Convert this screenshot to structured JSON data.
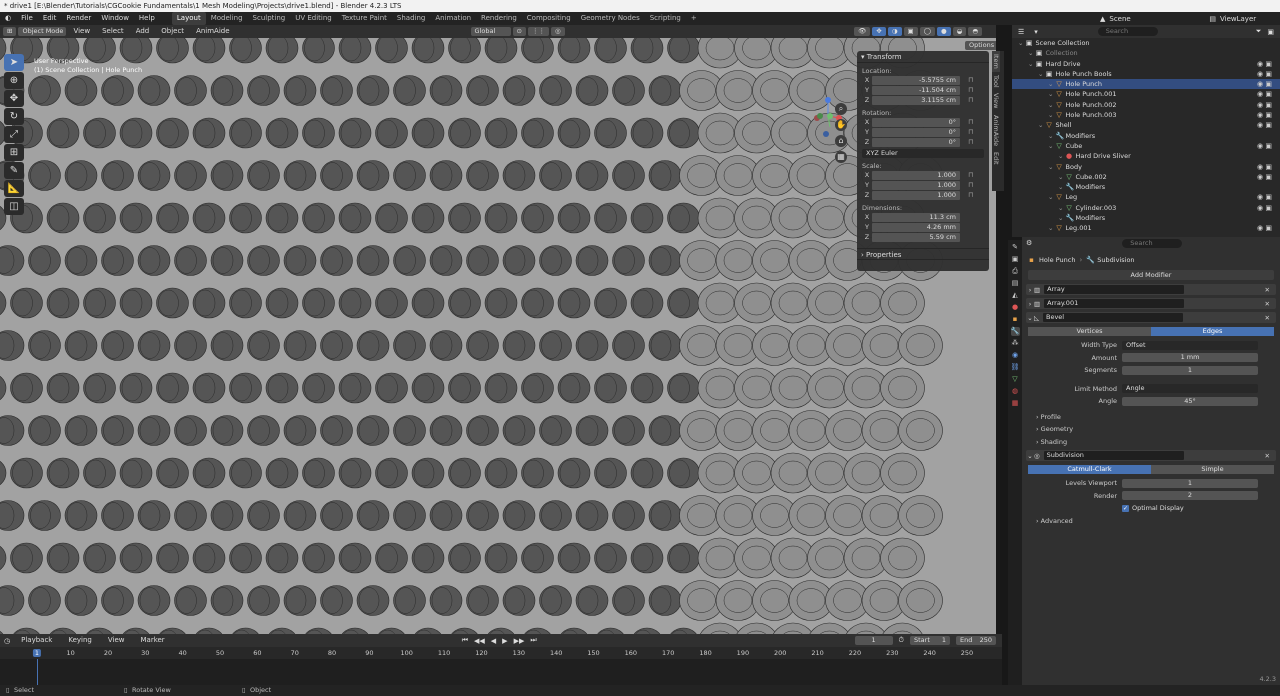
{
  "window_title": "* drive1 [E:\\Blender\\Tutorials\\CGCookie Fundamentals\\1 Mesh Modeling\\Projects\\drive1.blend] - Blender 4.2.3 LTS",
  "menu": [
    "File",
    "Edit",
    "Render",
    "Window",
    "Help"
  ],
  "workspaces": [
    "Layout",
    "Modeling",
    "Sculpting",
    "UV Editing",
    "Texture Paint",
    "Shading",
    "Animation",
    "Rendering",
    "Compositing",
    "Geometry Nodes",
    "Scripting"
  ],
  "active_workspace": "Layout",
  "scene": "Scene",
  "view_layer": "ViewLayer",
  "viewport_header": {
    "mode": "Object Mode",
    "menus": [
      "View",
      "Select",
      "Add",
      "Object",
      "AnimAide"
    ],
    "orientation": "Global",
    "options": "Options"
  },
  "viewport": {
    "perspective": "User Perspective",
    "context": "(1) Scene Collection | Hole Punch"
  },
  "tools": [
    "cursor",
    "select",
    "move",
    "rotate",
    "scale",
    "transform",
    "annotate",
    "measure",
    "add-cube"
  ],
  "npanel": {
    "title": "Transform",
    "location_label": "Location:",
    "location": [
      "-5.5755 cm",
      "-11.504 cm",
      "3.1155 cm"
    ],
    "rotation_label": "Rotation:",
    "rotation": [
      "0°",
      "0°",
      "0°"
    ],
    "rotation_mode": "XYZ Euler",
    "scale_label": "Scale:",
    "scale": [
      "1.000",
      "1.000",
      "1.000"
    ],
    "dimensions_label": "Dimensions:",
    "dimensions": [
      "11.3 cm",
      "4.26 mm",
      "5.59 cm"
    ],
    "axes": [
      "X",
      "Y",
      "Z"
    ],
    "properties": "Properties",
    "tabs": [
      "Item",
      "Tool",
      "View",
      "AnimAide",
      "Edit"
    ]
  },
  "outliner": {
    "search_placeholder": "Search",
    "items": [
      {
        "label": "Scene Collection",
        "indent": 0,
        "icon": "w"
      },
      {
        "label": "Collection",
        "indent": 1,
        "icon": "w",
        "dim": true
      },
      {
        "label": "Hard Drive",
        "indent": 1,
        "icon": "w"
      },
      {
        "label": "Hole Punch Bools",
        "indent": 2,
        "icon": "w"
      },
      {
        "label": "Hole Punch",
        "indent": 3,
        "icon": "o",
        "sel": true
      },
      {
        "label": "Hole Punch.001",
        "indent": 3,
        "icon": "o"
      },
      {
        "label": "Hole Punch.002",
        "indent": 3,
        "icon": "o"
      },
      {
        "label": "Hole Punch.003",
        "indent": 3,
        "icon": "o"
      },
      {
        "label": "Shell",
        "indent": 2,
        "icon": "o"
      },
      {
        "label": "Modifiers",
        "indent": 3,
        "icon": "b"
      },
      {
        "label": "Cube",
        "indent": 3,
        "icon": "g"
      },
      {
        "label": "Hard Drive Sliver",
        "indent": 4,
        "icon": "r"
      },
      {
        "label": "Body",
        "indent": 3,
        "icon": "o"
      },
      {
        "label": "Cube.002",
        "indent": 4,
        "icon": "g"
      },
      {
        "label": "Modifiers",
        "indent": 4,
        "icon": "b"
      },
      {
        "label": "Leg",
        "indent": 3,
        "icon": "o"
      },
      {
        "label": "Cylinder.003",
        "indent": 4,
        "icon": "g"
      },
      {
        "label": "Modifiers",
        "indent": 4,
        "icon": "b"
      },
      {
        "label": "Leg.001",
        "indent": 3,
        "icon": "o"
      }
    ]
  },
  "properties": {
    "search_placeholder": "Search",
    "breadcrumb_object": "Hole Punch",
    "breadcrumb_modifier": "Subdivision",
    "add_modifier": "Add Modifier",
    "modifiers": [
      "Array",
      "Array.001",
      "Bevel"
    ],
    "bevel": {
      "affect": [
        "Vertices",
        "Edges"
      ],
      "width_type_label": "Width Type",
      "width_type": "Offset",
      "amount_label": "Amount",
      "amount": "1 mm",
      "segments_label": "Segments",
      "segments": "1",
      "limit_method_label": "Limit Method",
      "limit_method": "Angle",
      "angle_label": "Angle",
      "angle": "45°",
      "subpanels": [
        "Profile",
        "Geometry",
        "Shading"
      ]
    },
    "subdivision": {
      "name": "Subdivision",
      "types": [
        "Catmull-Clark",
        "Simple"
      ],
      "levels_viewport_label": "Levels Viewport",
      "levels_viewport": "1",
      "render_label": "Render",
      "render": "2",
      "optimal_display": "Optimal Display",
      "advanced": "Advanced"
    }
  },
  "timeline": {
    "menus": [
      "Playback",
      "Keying",
      "View",
      "Marker"
    ],
    "current_frame": "1",
    "start_label": "Start",
    "start": "1",
    "end_label": "End",
    "end": "250",
    "ticks": [
      "1",
      "10",
      "20",
      "30",
      "40",
      "50",
      "60",
      "70",
      "80",
      "90",
      "100",
      "110",
      "120",
      "130",
      "140",
      "150",
      "160",
      "170",
      "180",
      "190",
      "200",
      "210",
      "220",
      "230",
      "240",
      "250"
    ]
  },
  "status": {
    "left": "Select",
    "middle": "Rotate View",
    "right": "Object"
  },
  "version": "4.2.3"
}
